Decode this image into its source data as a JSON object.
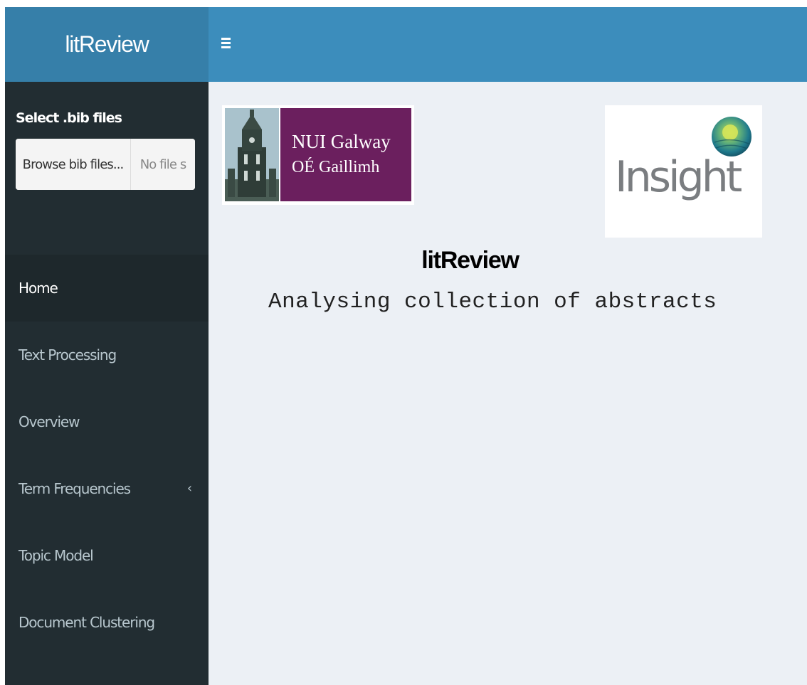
{
  "header": {
    "brand": "litReview"
  },
  "sidebar": {
    "file_input": {
      "label": "Select .bib files",
      "button_label": "Browse bib files...",
      "status_text": "No file s"
    },
    "items": [
      {
        "label": "Home",
        "active": true
      },
      {
        "label": "Text Processing"
      },
      {
        "label": "Overview"
      },
      {
        "label": "Term Frequencies",
        "has_submenu": true
      },
      {
        "label": "Topic Model"
      },
      {
        "label": "Document Clustering"
      }
    ]
  },
  "main": {
    "nui_logo": {
      "line1": "NUI Galway",
      "line2": "OÉ Gaillimh"
    },
    "insight_logo": {
      "text": "Insight"
    },
    "title": "litReview",
    "subtitle": "Analysing collection of abstracts"
  },
  "colors": {
    "header_brand_bg": "#367fa9",
    "header_bg": "#3c8dbc",
    "sidebar_bg": "#222d32",
    "sidebar_active_bg": "#1e282c",
    "content_bg": "#ecf0f5",
    "nui_purple": "#6b1f5e"
  },
  "icons": {
    "sidebar_toggle": "hamburger-icon",
    "submenu_indicator": "chevron-left-icon"
  }
}
